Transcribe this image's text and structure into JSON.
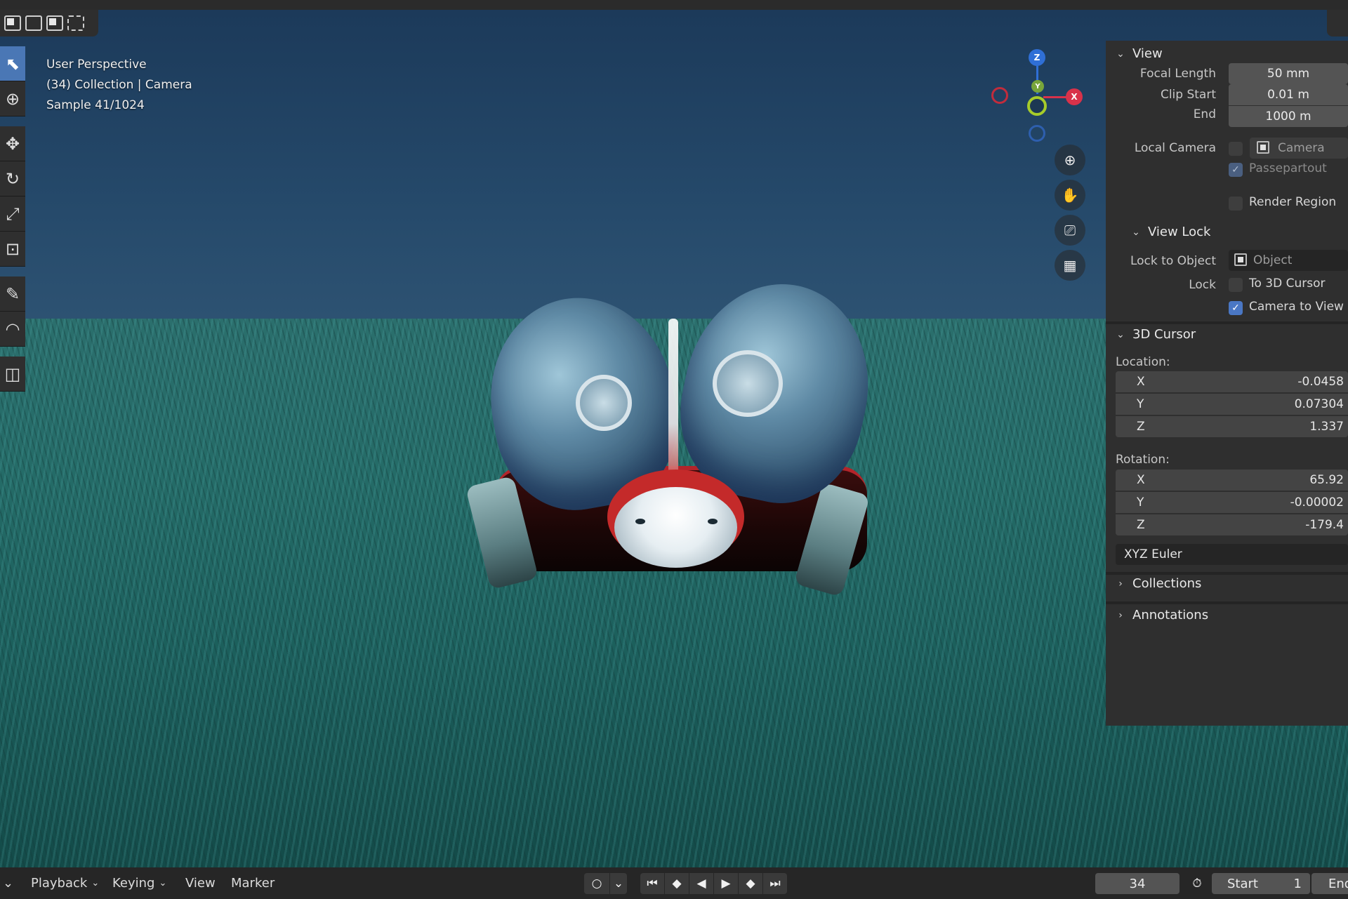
{
  "viewport": {
    "line1": "User Perspective",
    "line2": "(34) Collection | Camera",
    "line3": "Sample 41/1024"
  },
  "gizmo": {
    "z_label": "Z",
    "x_label": "X",
    "y_label": "Y"
  },
  "panel": {
    "view": {
      "title": "View",
      "focal_length_label": "Focal Length",
      "focal_length": "50 mm",
      "clip_start_label": "Clip Start",
      "clip_start": "0.01 m",
      "end_label": "End",
      "end": "1000 m",
      "local_camera_label": "Local Camera",
      "local_camera_value": "Camera",
      "passepartout_label": "Passepartout",
      "render_region_label": "Render Region"
    },
    "view_lock": {
      "title": "View Lock",
      "lock_to_object_label": "Lock to Object",
      "lock_to_object_placeholder": "Object",
      "lock_label": "Lock",
      "to_3d_cursor_label": "To 3D Cursor",
      "camera_to_view_label": "Camera to View",
      "camera_to_view_checked": true
    },
    "cursor": {
      "title": "3D Cursor",
      "location_label": "Location:",
      "location": [
        {
          "axis": "X",
          "value": "-0.0458"
        },
        {
          "axis": "Y",
          "value": "0.07304"
        },
        {
          "axis": "Z",
          "value": "1.337"
        }
      ],
      "rotation_label": "Rotation:",
      "rotation": [
        {
          "axis": "X",
          "value": "65.92"
        },
        {
          "axis": "Y",
          "value": "-0.00002"
        },
        {
          "axis": "Z",
          "value": "-179.4"
        }
      ],
      "rotation_mode": "XYZ Euler"
    },
    "collections_title": "Collections",
    "annotations_title": "Annotations"
  },
  "timeline": {
    "playback": "Playback",
    "keying": "Keying",
    "view": "View",
    "marker": "Marker",
    "current_frame": "34",
    "start_label": "Start",
    "start_value": "1",
    "end_label": "End"
  },
  "colors": {
    "accent": "#4a77c4",
    "axis_x": "#d8324a",
    "axis_y": "#78a53a",
    "axis_z": "#2f6fd6"
  }
}
